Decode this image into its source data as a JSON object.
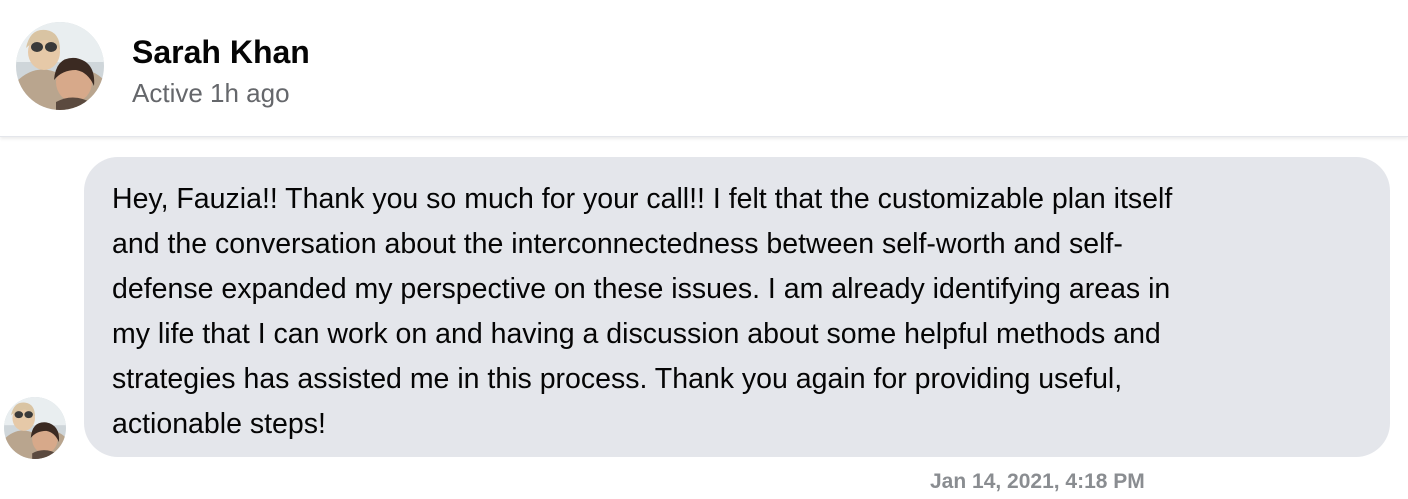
{
  "header": {
    "contact_name": "Sarah Khan",
    "status": "Active 1h ago",
    "avatar_icon": "profile-photo-avatar"
  },
  "conversation": {
    "messages": [
      {
        "sender": "Sarah Khan",
        "text": "Hey, Fauzia!! Thank you so much for your call!! I felt that the customizable plan itself\nand the conversation about the interconnectedness between self-worth and self-\ndefense expanded my perspective on these issues. I am already identifying areas in\nmy life that I can work on and having a discussion about some helpful methods and\nstrategies has assisted me in this process. Thank you again for providing useful,\nactionable steps!",
        "timestamp": "Jan 14, 2021, 4:18 PM"
      }
    ]
  },
  "colors": {
    "bubble_background": "#e4e6eb",
    "status_text": "#65676b",
    "timestamp_text": "#8a8d91",
    "primary_text": "#050505"
  }
}
